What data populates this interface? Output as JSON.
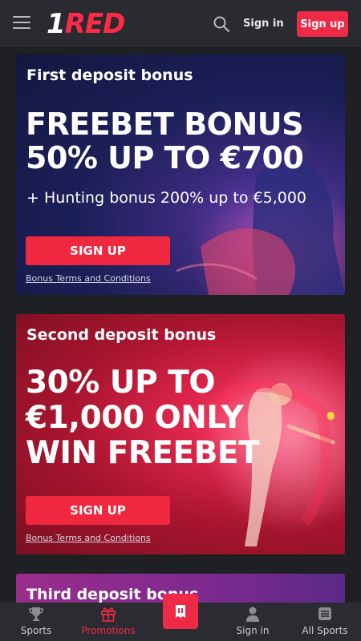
{
  "header": {
    "logo_prefix": "1",
    "logo_text": "RED",
    "signin_label": "Sign in",
    "signup_label": "Sign up",
    "accent_color": "#ee2a46"
  },
  "promotions": [
    {
      "eyebrow": "First deposit bonus",
      "headline": "FREEBET BONUS\n50% UP TO €700",
      "subline": "+ Hunting bonus 200% up to €5,000",
      "cta_label": "SIGN UP",
      "terms_label": "Bonus Terms and Conditions"
    },
    {
      "eyebrow": "Second deposit bonus",
      "headline": "30% UP TO\n€1,000 ONLY\nWIN FREEBET",
      "cta_label": "SIGN UP",
      "terms_label": "Bonus Terms and Conditions"
    },
    {
      "eyebrow": "Third deposit bonus"
    }
  ],
  "bottom_nav": {
    "items": [
      {
        "label": "Sports",
        "icon": "trophy-icon"
      },
      {
        "label": "Promotions",
        "icon": "gift-icon"
      },
      {
        "label": "Sign in",
        "icon": "user-icon"
      },
      {
        "label": "All Sports",
        "icon": "list-icon"
      }
    ],
    "center_icon": "betslip-icon",
    "active": "Promotions"
  }
}
